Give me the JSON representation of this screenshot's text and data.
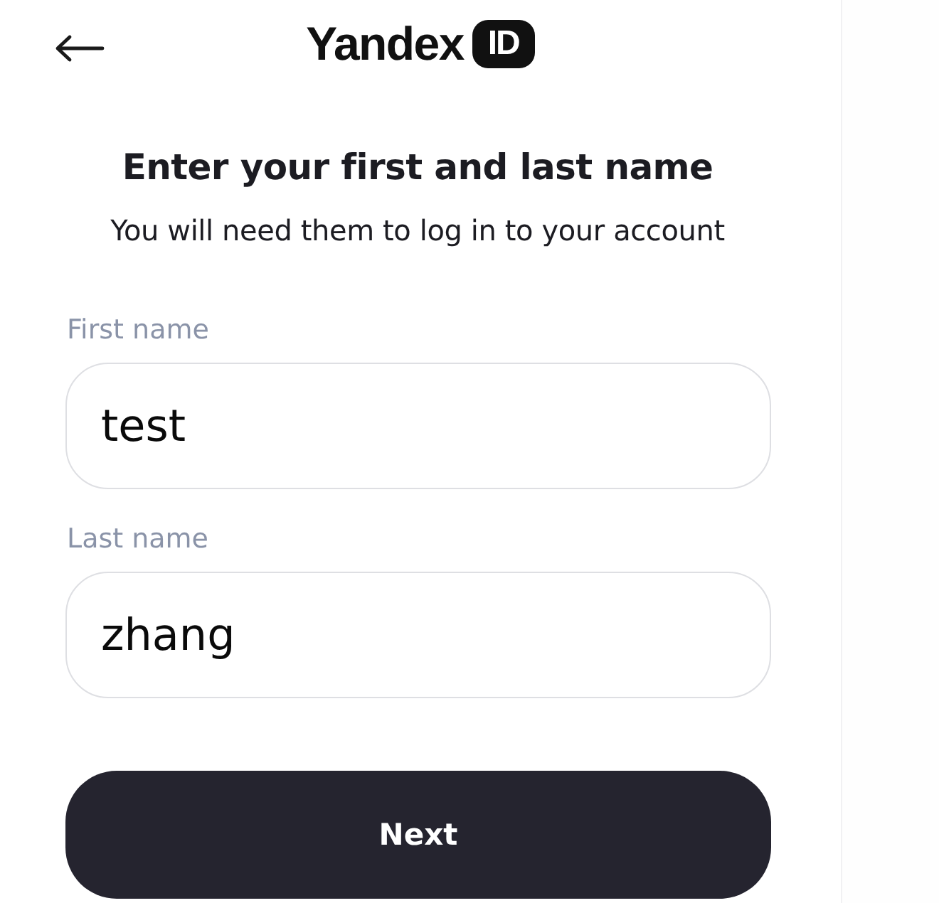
{
  "header": {
    "back": {
      "kind": "arrow"
    },
    "logo": {
      "wordmark": "Yandex",
      "badge": "ID"
    }
  },
  "title": "Enter your first and last name",
  "subtitle": "You will need them to log in to your account",
  "fields": [
    {
      "label": "First name",
      "value": "test"
    },
    {
      "label": "Last name",
      "value": "zhang"
    }
  ],
  "primary_button": {
    "label": "Next"
  }
}
